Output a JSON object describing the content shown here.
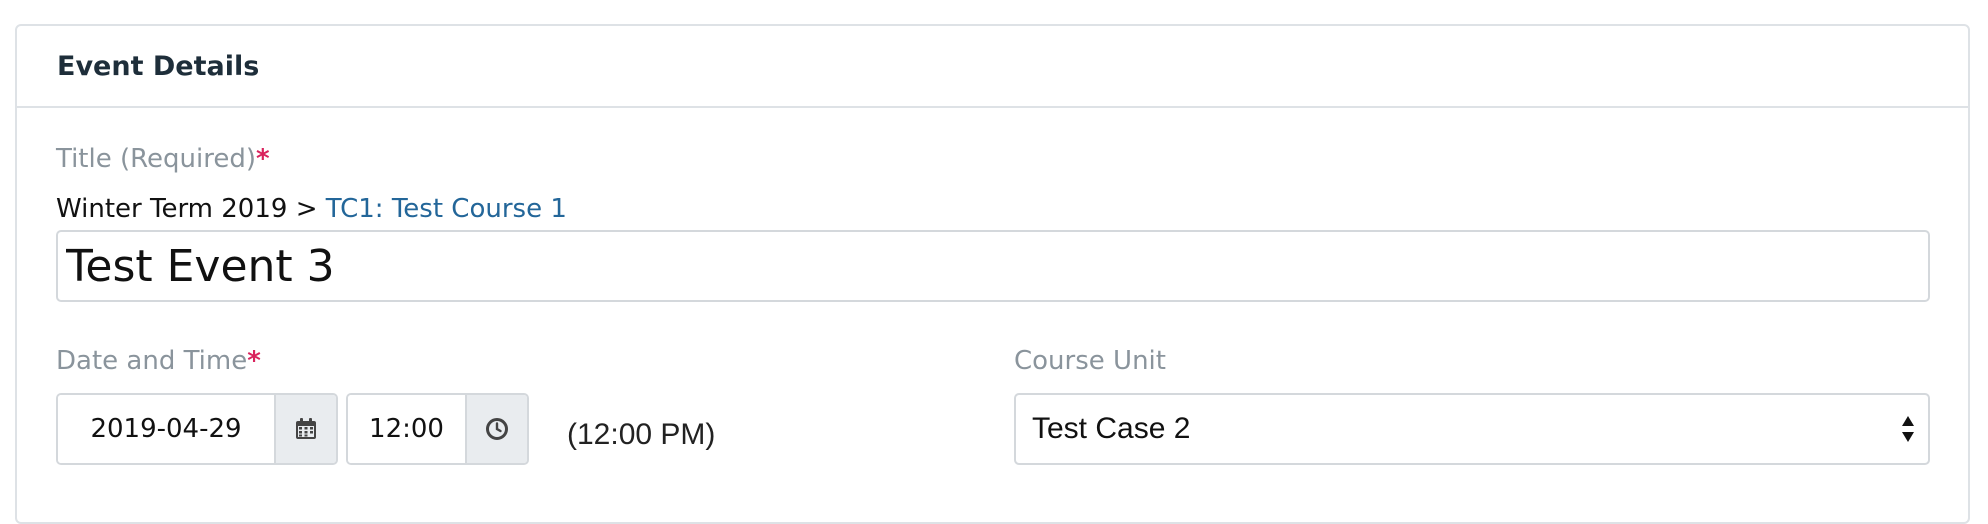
{
  "panel": {
    "title": "Event Details"
  },
  "title_field": {
    "label": "Title (Required)",
    "required_mark": "*",
    "breadcrumb_term": "Winter Term 2019 > ",
    "breadcrumb_course": "TC1: Test Course 1",
    "value": "Test Event 3"
  },
  "date_time": {
    "label": "Date and Time",
    "required_mark": "*",
    "date_value": "2019-04-29",
    "time_value": "12:00",
    "time_readout": "(12:00 PM)",
    "icons": {
      "date": "calendar-icon",
      "time": "clock-icon"
    }
  },
  "course_unit": {
    "label": "Course Unit",
    "selected": "Test Case 2",
    "icon": "select-arrows-icon"
  },
  "colors": {
    "required": "#d9235d",
    "link": "#236699",
    "label": "#8a949c",
    "heading": "#1e2e3a",
    "border": "#d4d8dc"
  }
}
